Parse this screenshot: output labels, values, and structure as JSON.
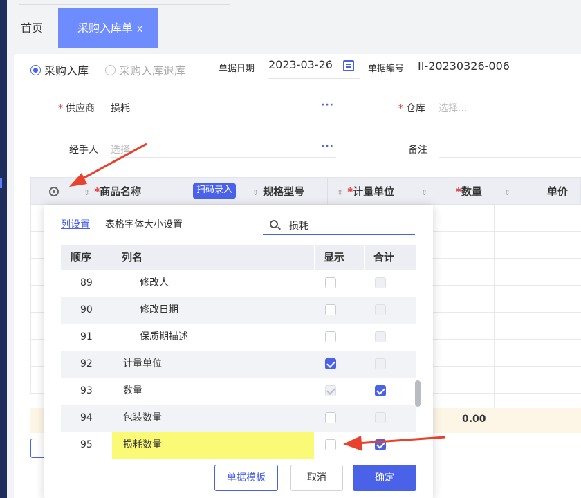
{
  "tabs": {
    "home": "首页",
    "active": "采购入库单",
    "close": "x"
  },
  "form": {
    "radio_in": "采购入库",
    "radio_return": "采购入库退库",
    "date_label": "单据日期",
    "date_value": "2023-03-26",
    "no_label": "单据编号",
    "no_value": "II-20230326-006",
    "supplier_label": "供应商",
    "supplier_value": "损耗",
    "warehouse_label": "仓库",
    "warehouse_placeholder": "选择...",
    "handler_label": "经手人",
    "handler_placeholder": "选择",
    "remark_label": "备注",
    "more": "···",
    "required": "*"
  },
  "table": {
    "col_product": "商品名称",
    "scan_button": "扫码录入",
    "col_spec": "规格型号",
    "col_unit": "计量单位",
    "col_qty": "数量",
    "col_price": "单价",
    "sort": "⇕",
    "sum_qty": "0.00"
  },
  "popup": {
    "tab_columns": "列设置",
    "tab_font": "表格字体大小设置",
    "search_value": "损耗",
    "head_order": "顺序",
    "head_name": "列名",
    "head_show": "显示",
    "head_sum": "合计",
    "rows": [
      {
        "order": "89",
        "name": "修改人",
        "indent": 2,
        "show": "off",
        "sum": "disabled"
      },
      {
        "order": "90",
        "name": "修改日期",
        "indent": 2,
        "show": "off",
        "sum": "disabled"
      },
      {
        "order": "91",
        "name": "保质期描述",
        "indent": 2,
        "show": "off",
        "sum": "disabled"
      },
      {
        "order": "92",
        "name": "计量单位",
        "indent": 1,
        "show": "on",
        "sum": "disabled"
      },
      {
        "order": "93",
        "name": "数量",
        "indent": 1,
        "show": "disabled-on",
        "sum": "on"
      },
      {
        "order": "94",
        "name": "包装数量",
        "indent": 1,
        "show": "off",
        "sum": "disabled"
      },
      {
        "order": "95",
        "name": "损耗数量",
        "indent": 1,
        "show": "off",
        "sum": "on",
        "highlight": true
      }
    ],
    "btn_template": "单据模板",
    "btn_cancel": "取消",
    "btn_ok": "确定"
  },
  "colors": {
    "accent": "#4a62e8",
    "tab_active": "#6f8cff",
    "highlight": "#fbfa76",
    "arrow": "#e8412c",
    "sidebar": "#1f2d5c"
  }
}
